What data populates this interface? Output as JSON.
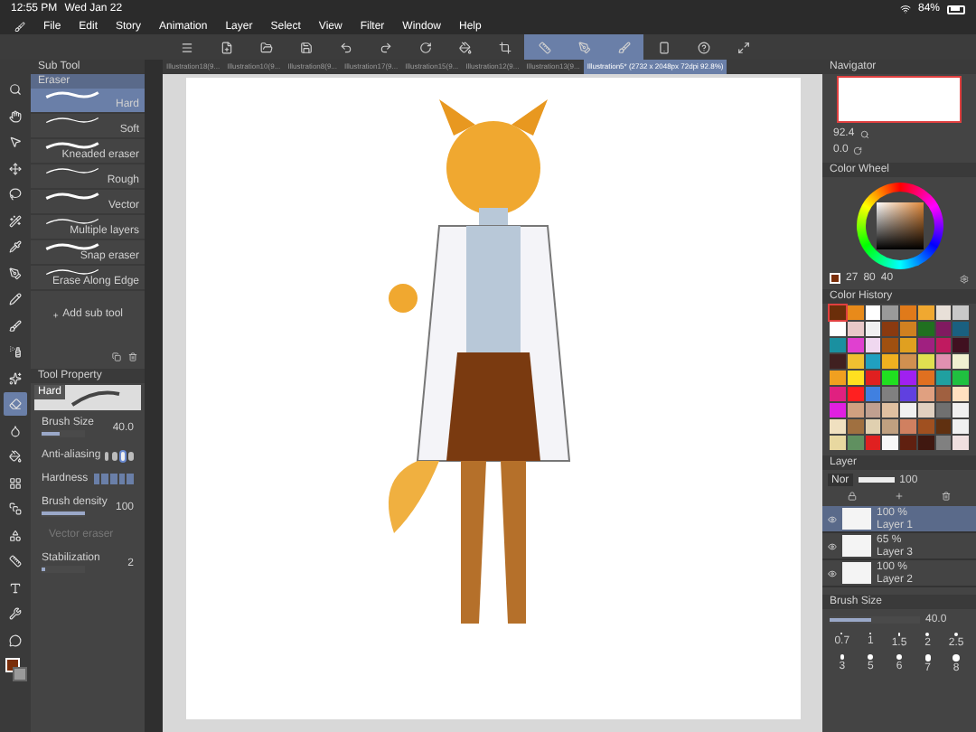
{
  "status_bar": {
    "time": "12:55 PM",
    "date": "Wed Jan 22",
    "battery": "84%"
  },
  "menu": [
    "File",
    "Edit",
    "Story",
    "Animation",
    "Layer",
    "Select",
    "View",
    "Filter",
    "Window",
    "Help"
  ],
  "toolbar": [
    {
      "kind": "menu",
      "selected": false
    },
    {
      "kind": "new",
      "selected": false
    },
    {
      "kind": "open",
      "selected": false
    },
    {
      "kind": "save",
      "selected": false
    },
    {
      "kind": "undo",
      "selected": false
    },
    {
      "kind": "redo",
      "selected": false
    },
    {
      "kind": "transform",
      "selected": false
    },
    {
      "kind": "fill",
      "selected": false
    },
    {
      "kind": "crop",
      "selected": false
    },
    {
      "kind": "ruler",
      "selected": true
    },
    {
      "kind": "pen",
      "selected": true
    },
    {
      "kind": "brush",
      "selected": true
    },
    {
      "kind": "phone",
      "selected": false
    },
    {
      "kind": "help",
      "selected": false
    },
    {
      "kind": "fullscreen",
      "selected": false
    }
  ],
  "tabs": [
    {
      "label": "Illustration18(9...",
      "selected": false
    },
    {
      "label": "Illustration10(9...",
      "selected": false
    },
    {
      "label": "Illustration8(9...",
      "selected": false
    },
    {
      "label": "Illustration17(9...",
      "selected": false
    },
    {
      "label": "Illustration15(9...",
      "selected": false
    },
    {
      "label": "Illustration12(9...",
      "selected": false
    },
    {
      "label": "Illustration13(9...",
      "selected": false
    },
    {
      "label": "Illustration5* (2732 x 2048px 72dpi 92.8%)",
      "selected": true
    }
  ],
  "tools": [
    {
      "kind": "zoom",
      "selected": false
    },
    {
      "kind": "hand",
      "selected": false
    },
    {
      "kind": "operation",
      "selected": false
    },
    {
      "kind": "move",
      "selected": false
    },
    {
      "kind": "lasso",
      "selected": false
    },
    {
      "kind": "wand",
      "selected": false
    },
    {
      "kind": "eyedropper",
      "selected": false
    },
    {
      "kind": "pen",
      "selected": false
    },
    {
      "kind": "pencil",
      "selected": false
    },
    {
      "kind": "brush",
      "selected": false
    },
    {
      "kind": "airbrush",
      "selected": false
    },
    {
      "kind": "decoration",
      "selected": false
    },
    {
      "kind": "eraser",
      "selected": true
    },
    {
      "kind": "blend",
      "selected": false
    },
    {
      "kind": "fill",
      "selected": false
    },
    {
      "kind": "frame",
      "selected": false
    },
    {
      "kind": "gradient",
      "selected": false
    },
    {
      "kind": "shape",
      "selected": false
    },
    {
      "kind": "ruler",
      "selected": false
    },
    {
      "kind": "text",
      "selected": false
    },
    {
      "kind": "correct",
      "selected": false
    },
    {
      "kind": "balloon",
      "selected": false
    }
  ],
  "color_slots": [
    {
      "kind": "main",
      "color": "#7a2e0a"
    },
    {
      "kind": "sub",
      "color": "#9a9a9a"
    }
  ],
  "sub_tool": {
    "title": "Sub Tool",
    "group": "Eraser",
    "add_label": "Add sub tool",
    "items": [
      {
        "label": "Hard",
        "selected": true
      },
      {
        "label": "Soft",
        "selected": false
      },
      {
        "label": "Kneaded eraser",
        "selected": false
      },
      {
        "label": "Rough",
        "selected": false
      },
      {
        "label": "Vector",
        "selected": false
      },
      {
        "label": "Multiple layers",
        "selected": false
      },
      {
        "label": "Snap eraser",
        "selected": false
      },
      {
        "label": "Erase Along Edge",
        "selected": false
      }
    ]
  },
  "tool_property": {
    "title": "Tool Property",
    "preset": "Hard",
    "brush_size": {
      "label": "Brush Size",
      "value": "40.0",
      "level": 0.4
    },
    "anti_aliasing": {
      "label": "Anti-aliasing",
      "options": [
        {
          "selected": false
        },
        {
          "selected": false
        },
        {
          "selected": true
        },
        {
          "selected": false
        }
      ]
    },
    "hardness": {
      "label": "Hardness",
      "steps": [
        {
          "on": true
        },
        {
          "on": true
        },
        {
          "on": true
        },
        {
          "on": true
        },
        {
          "on": true
        }
      ]
    },
    "brush_density": {
      "label": "Brush density",
      "value": "100",
      "level": 1
    },
    "vector_eraser": {
      "label": "Vector eraser",
      "disabled": true
    },
    "stabilization": {
      "label": "Stabilization",
      "value": "2",
      "level": 0.1
    }
  },
  "navigator": {
    "title": "Navigator",
    "zoom": "92.4",
    "angle": "0.0"
  },
  "color_wheel": {
    "title": "Color Wheel",
    "h": "27",
    "s": "80",
    "v": "40"
  },
  "color_history": {
    "title": "Color History",
    "swatches": [
      {
        "color": "#6b2e0a",
        "selected": true
      },
      {
        "color": "#e88a1a",
        "selected": false
      },
      {
        "color": "#ffffff",
        "selected": false
      },
      {
        "color": "#9a9a9a",
        "selected": false
      },
      {
        "color": "#e07a1a",
        "selected": false
      },
      {
        "color": "#f0a830",
        "selected": false
      },
      {
        "color": "#e8e0d8",
        "selected": false
      },
      {
        "color": "#c8c8c8",
        "selected": false
      },
      {
        "color": "#ffffff",
        "selected": false
      },
      {
        "color": "#e8c8c8",
        "selected": false
      },
      {
        "color": "#f0f0f0",
        "selected": false
      },
      {
        "color": "#8a3a10",
        "selected": false
      },
      {
        "color": "#d08020",
        "selected": false
      },
      {
        "color": "#207020",
        "selected": false
      },
      {
        "color": "#801a60",
        "selected": false
      },
      {
        "color": "#1a6080",
        "selected": false
      },
      {
        "color": "#1a90a0",
        "selected": false
      },
      {
        "color": "#e040d0",
        "selected": false
      },
      {
        "color": "#f0d8f0",
        "selected": false
      },
      {
        "color": "#a05010",
        "selected": false
      },
      {
        "color": "#e0a020",
        "selected": false
      },
      {
        "color": "#a02080",
        "selected": false
      },
      {
        "color": "#c01a60",
        "selected": false
      },
      {
        "color": "#401020",
        "selected": false
      },
      {
        "color": "#402020",
        "selected": false
      },
      {
        "color": "#f0c030",
        "selected": false
      },
      {
        "color": "#20a0c0",
        "selected": false
      },
      {
        "color": "#f0b020",
        "selected": false
      },
      {
        "color": "#d09050",
        "selected": false
      },
      {
        "color": "#e0e050",
        "selected": false
      },
      {
        "color": "#e090b0",
        "selected": false
      },
      {
        "color": "#f0f0d0",
        "selected": false
      },
      {
        "color": "#f0a020",
        "selected": false
      },
      {
        "color": "#ffe020",
        "selected": false
      },
      {
        "color": "#e02020",
        "selected": false
      },
      {
        "color": "#20e020",
        "selected": false
      },
      {
        "color": "#a020f0",
        "selected": false
      },
      {
        "color": "#e07020",
        "selected": false
      },
      {
        "color": "#20a0a0",
        "selected": false
      },
      {
        "color": "#20c040",
        "selected": false
      },
      {
        "color": "#e02080",
        "selected": false
      },
      {
        "color": "#ff2020",
        "selected": false
      },
      {
        "color": "#4080e0",
        "selected": false
      },
      {
        "color": "#808080",
        "selected": false
      },
      {
        "color": "#6040e0",
        "selected": false
      },
      {
        "color": "#e0a080",
        "selected": false
      },
      {
        "color": "#a06040",
        "selected": false
      },
      {
        "color": "#ffe0c0",
        "selected": false
      },
      {
        "color": "#e020e0",
        "selected": false
      },
      {
        "color": "#d0a080",
        "selected": false
      },
      {
        "color": "#c0a090",
        "selected": false
      },
      {
        "color": "#e0c0a0",
        "selected": false
      },
      {
        "color": "#f0f0f0",
        "selected": false
      },
      {
        "color": "#e0d0c0",
        "selected": false
      },
      {
        "color": "#707070",
        "selected": false
      },
      {
        "color": "#f0f0f0",
        "selected": false
      },
      {
        "color": "#f0e0c0",
        "selected": false
      },
      {
        "color": "#a07040",
        "selected": false
      },
      {
        "color": "#e0d0b0",
        "selected": false
      },
      {
        "color": "#c0a080",
        "selected": false
      },
      {
        "color": "#d08060",
        "selected": false
      },
      {
        "color": "#a05020",
        "selected": false
      },
      {
        "color": "#603010",
        "selected": false
      },
      {
        "color": "#f0f0f0",
        "selected": false
      },
      {
        "color": "#e8d8a0",
        "selected": false
      },
      {
        "color": "#609060",
        "selected": false
      },
      {
        "color": "#e02020",
        "selected": false
      },
      {
        "color": "#f8f8f8",
        "selected": false
      },
      {
        "color": "#602010",
        "selected": false
      },
      {
        "color": "#401810",
        "selected": false
      },
      {
        "color": "#808080",
        "selected": false
      },
      {
        "color": "#f0e0e0",
        "selected": false
      }
    ]
  },
  "layer_panel": {
    "title": "Layer",
    "blend_mode": "Nor",
    "opacity": "100",
    "layers": [
      {
        "opacity": "100 %",
        "name": "Layer 1",
        "visible": true,
        "selected": true
      },
      {
        "opacity": "65 %",
        "name": "Layer 3",
        "visible": true,
        "selected": false
      },
      {
        "opacity": "100 %",
        "name": "Layer 2",
        "visible": true,
        "selected": false
      }
    ]
  },
  "brush_size_panel": {
    "title": "Brush Size",
    "value": "40.0",
    "level": 0.45,
    "sizes": [
      {
        "label": "0.7",
        "selected": false
      },
      {
        "label": "1",
        "selected": false
      },
      {
        "label": "1.5",
        "selected": false
      },
      {
        "label": "2",
        "selected": false
      },
      {
        "label": "2.5",
        "selected": false
      },
      {
        "label": "3",
        "selected": false
      },
      {
        "label": "5",
        "selected": false
      },
      {
        "label": "6",
        "selected": false
      },
      {
        "label": "7",
        "selected": false
      },
      {
        "label": "8",
        "selected": false
      }
    ]
  }
}
